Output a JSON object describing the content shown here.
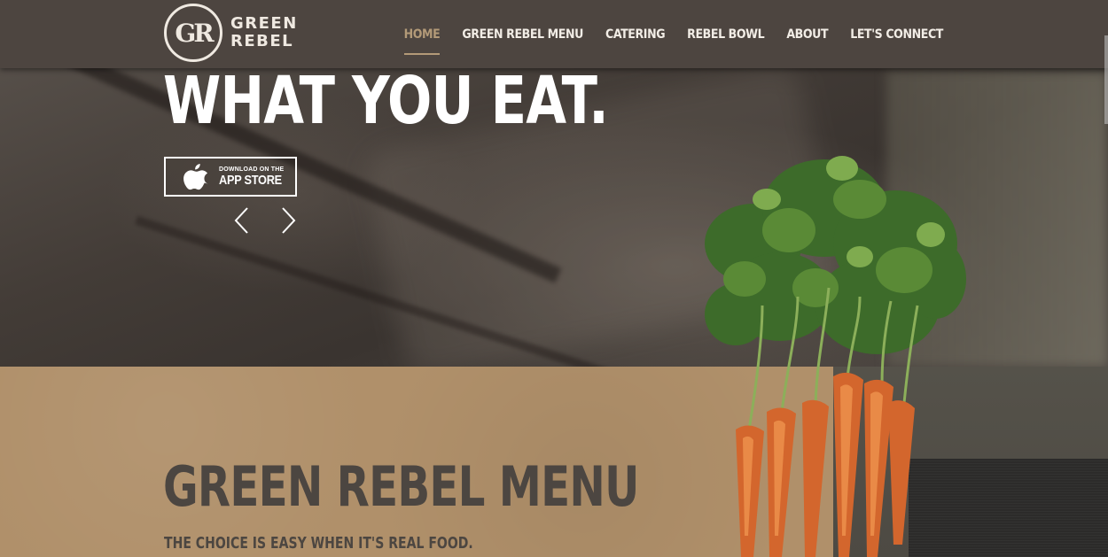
{
  "brand": {
    "logo_monogram": "GR",
    "name_line1": "GREEN",
    "name_line2": "REBEL"
  },
  "nav": {
    "items": [
      {
        "label": "HOME",
        "active": true
      },
      {
        "label": "GREEN REBEL MENU",
        "active": false
      },
      {
        "label": "CATERING",
        "active": false
      },
      {
        "label": "REBEL BOWL",
        "active": false
      },
      {
        "label": "ABOUT",
        "active": false
      },
      {
        "label": "LET'S CONNECT",
        "active": false
      }
    ]
  },
  "hero": {
    "heading": "WHAT YOU EAT.",
    "app_button": {
      "small": "DOWNLOAD ON THE",
      "big": "APP STORE",
      "icon": "apple-icon"
    },
    "prev_icon": "chevron-left-icon",
    "next_icon": "chevron-right-icon"
  },
  "menu_section": {
    "title": "GREEN REBEL MENU",
    "subtitle": "THE CHOICE IS EASY WHEN IT'S REAL FOOD."
  },
  "colors": {
    "navbar_bg": "#4d4540",
    "nav_active": "#b39a78",
    "kraft": "#b0906a",
    "heading_dark": "#4c4641"
  }
}
